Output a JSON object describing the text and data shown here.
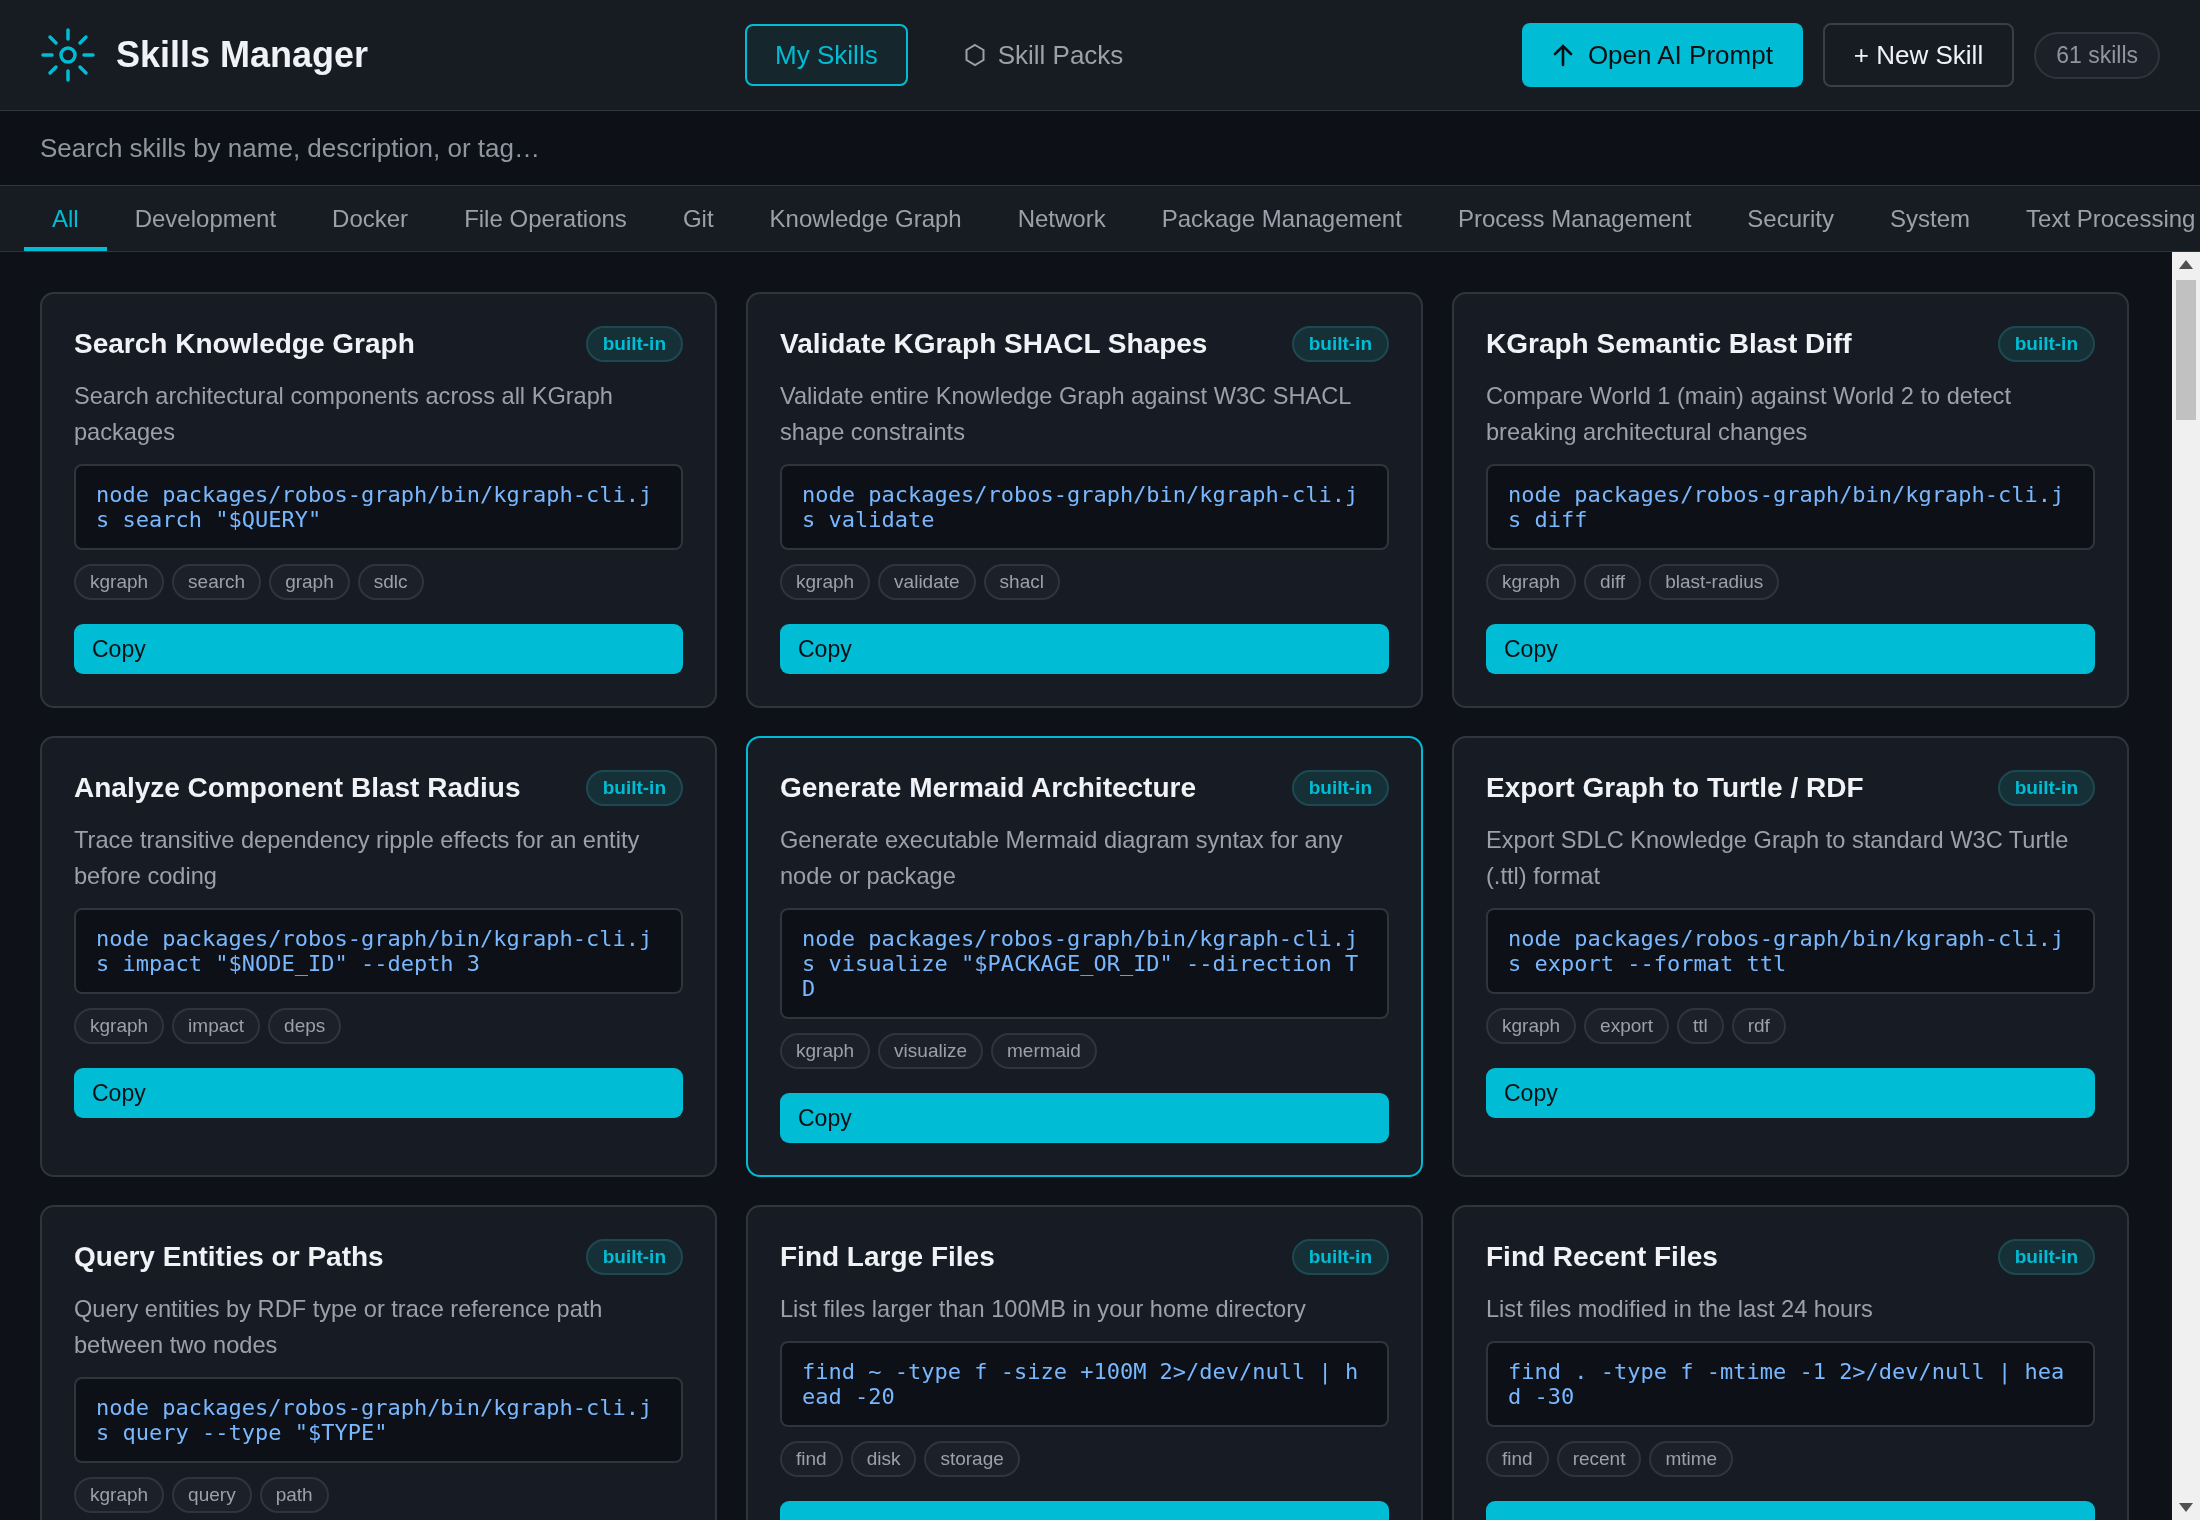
{
  "header": {
    "title": "Skills Manager",
    "nav": [
      {
        "label": "My Skills",
        "selected": true
      },
      {
        "label": "Skill Packs",
        "selected": false
      }
    ],
    "prompt_button": "Open AI Prompt",
    "new_button": "+ New Skill",
    "count": "61 skills"
  },
  "search": {
    "placeholder": "Search skills by name, description, or tag…"
  },
  "categories": [
    {
      "label": "All",
      "selected": true
    },
    {
      "label": "Development",
      "selected": false
    },
    {
      "label": "Docker",
      "selected": false
    },
    {
      "label": "File Operations",
      "selected": false
    },
    {
      "label": "Git",
      "selected": false
    },
    {
      "label": "Knowledge Graph",
      "selected": false
    },
    {
      "label": "Network",
      "selected": false
    },
    {
      "label": "Package Management",
      "selected": false
    },
    {
      "label": "Process Management",
      "selected": false
    },
    {
      "label": "Security",
      "selected": false
    },
    {
      "label": "System",
      "selected": false
    },
    {
      "label": "Text Processing",
      "selected": false
    }
  ],
  "skills": [
    {
      "title": "Search Knowledge Graph",
      "badge": "built-in",
      "description": "Search architectural components across all KGraph packages",
      "command": "node packages/robos-graph/bin/kgraph-cli.js search \"$QUERY\"",
      "tags": [
        "kgraph",
        "search",
        "graph",
        "sdlc"
      ],
      "copy": "Copy",
      "highlighted": false
    },
    {
      "title": "Validate KGraph SHACL Shapes",
      "badge": "built-in",
      "description": "Validate entire Knowledge Graph against W3C SHACL shape constraints",
      "command": "node packages/robos-graph/bin/kgraph-cli.js validate",
      "tags": [
        "kgraph",
        "validate",
        "shacl"
      ],
      "copy": "Copy",
      "highlighted": false
    },
    {
      "title": "KGraph Semantic Blast Diff",
      "badge": "built-in",
      "description": "Compare World 1 (main) against World 2 to detect breaking architectural changes",
      "command": "node packages/robos-graph/bin/kgraph-cli.js diff",
      "tags": [
        "kgraph",
        "diff",
        "blast-radius"
      ],
      "copy": "Copy",
      "highlighted": false
    },
    {
      "title": "Analyze Component Blast Radius",
      "badge": "built-in",
      "description": "Trace transitive dependency ripple effects for an entity before coding",
      "command": "node packages/robos-graph/bin/kgraph-cli.js impact \"$NODE_ID\" --depth 3",
      "tags": [
        "kgraph",
        "impact",
        "deps"
      ],
      "copy": "Copy",
      "highlighted": false
    },
    {
      "title": "Generate Mermaid Architecture",
      "badge": "built-in",
      "description": "Generate executable Mermaid diagram syntax for any node or package",
      "command": "node packages/robos-graph/bin/kgraph-cli.js visualize \"$PACKAGE_OR_ID\" --direction TD",
      "tags": [
        "kgraph",
        "visualize",
        "mermaid"
      ],
      "copy": "Copy",
      "highlighted": true
    },
    {
      "title": "Export Graph to Turtle / RDF",
      "badge": "built-in",
      "description": "Export SDLC Knowledge Graph to standard W3C Turtle (.ttl) format",
      "command": "node packages/robos-graph/bin/kgraph-cli.js export --format ttl",
      "tags": [
        "kgraph",
        "export",
        "ttl",
        "rdf"
      ],
      "copy": "Copy",
      "highlighted": false
    },
    {
      "title": "Query Entities or Paths",
      "badge": "built-in",
      "description": "Query entities by RDF type or trace reference path between two nodes",
      "command": "node packages/robos-graph/bin/kgraph-cli.js query --type \"$TYPE\"",
      "tags": [
        "kgraph",
        "query",
        "path"
      ],
      "highlighted": false
    },
    {
      "title": "Find Large Files",
      "badge": "built-in",
      "description": "List files larger than 100MB in your home directory",
      "command": "find ~ -type f -size +100M 2>/dev/null | head -20",
      "tags": [
        "find",
        "disk",
        "storage"
      ],
      "copy_cut": true,
      "highlighted": false
    },
    {
      "title": "Find Recent Files",
      "badge": "built-in",
      "description": "List files modified in the last 24 hours",
      "command": "find . -type f -mtime -1 2>/dev/null | head -30",
      "tags": [
        "find",
        "recent",
        "mtime"
      ],
      "copy_cut": true,
      "highlighted": false
    }
  ]
}
